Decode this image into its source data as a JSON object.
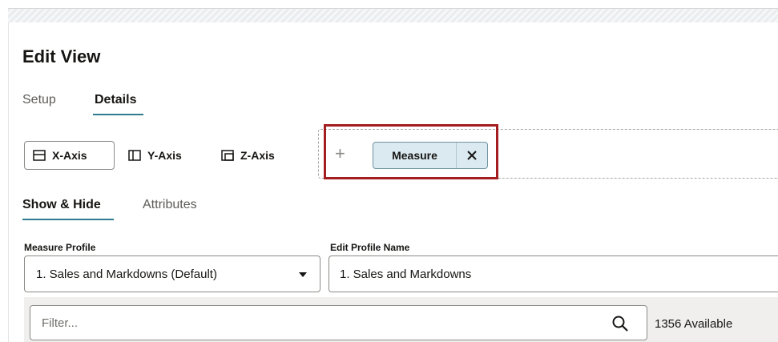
{
  "header": {
    "title": "Edit View"
  },
  "tabs": [
    {
      "label": "Setup"
    },
    {
      "label": "Details",
      "selected": true
    }
  ],
  "axis_buttons": [
    {
      "label": "X-Axis",
      "icon": "x-axis-layout-icon",
      "selected": true
    },
    {
      "label": "Y-Axis",
      "icon": "y-axis-layout-icon"
    },
    {
      "label": "Z-Axis",
      "icon": "z-axis-layout-icon"
    }
  ],
  "dropzone": {
    "add_icon": "plus-icon",
    "chip": {
      "label": "Measure",
      "close_icon": "close-icon"
    }
  },
  "subtabs": [
    {
      "label": "Show & Hide",
      "selected": true
    },
    {
      "label": "Attributes"
    }
  ],
  "measure_profile": {
    "label": "Measure Profile",
    "value": "1. Sales and Markdowns (Default)"
  },
  "edit_profile_name": {
    "label": "Edit Profile Name",
    "value": "1. Sales and Markdowns"
  },
  "filter": {
    "placeholder": "Filter...",
    "available": "1356 Available",
    "icon": "search-icon"
  },
  "colors": {
    "accent": "#2e7c8e",
    "highlight": "#a41d1f",
    "chip_bg": "#dbeaf0"
  }
}
